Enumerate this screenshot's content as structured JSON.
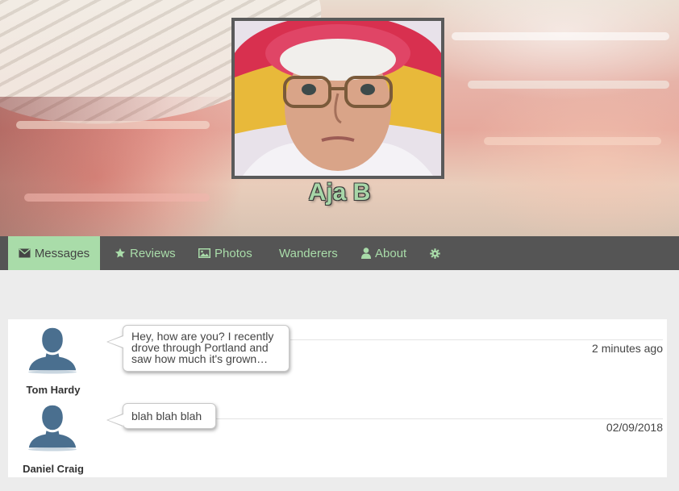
{
  "profile": {
    "name": "Aja B",
    "photo_alt": "elderly woman wearing a red straw hat and glasses"
  },
  "tabs": [
    {
      "label": "Messages",
      "icon": "envelope-icon",
      "active": true
    },
    {
      "label": "Reviews",
      "icon": "star-icon",
      "active": false
    },
    {
      "label": "Photos",
      "icon": "image-icon",
      "active": false
    },
    {
      "label": "Wanderers",
      "icon": "",
      "active": false
    },
    {
      "label": "About",
      "icon": "user-icon",
      "active": false
    },
    {
      "label": "",
      "icon": "gear-icon",
      "active": false
    }
  ],
  "messages": [
    {
      "sender": "Tom Hardy",
      "preview": "Hey, how are you? I recently drove through Portland and saw how much it's grown…",
      "time": "2 minutes ago"
    },
    {
      "sender": "Daniel Craig",
      "preview": "blah blah blah",
      "time": "02/09/2018"
    }
  ],
  "colors": {
    "accent": "#a9dca9",
    "tabbar": "#555555",
    "page_bg": "#ececec",
    "avatar_silhouette": "#4a6f8f"
  }
}
